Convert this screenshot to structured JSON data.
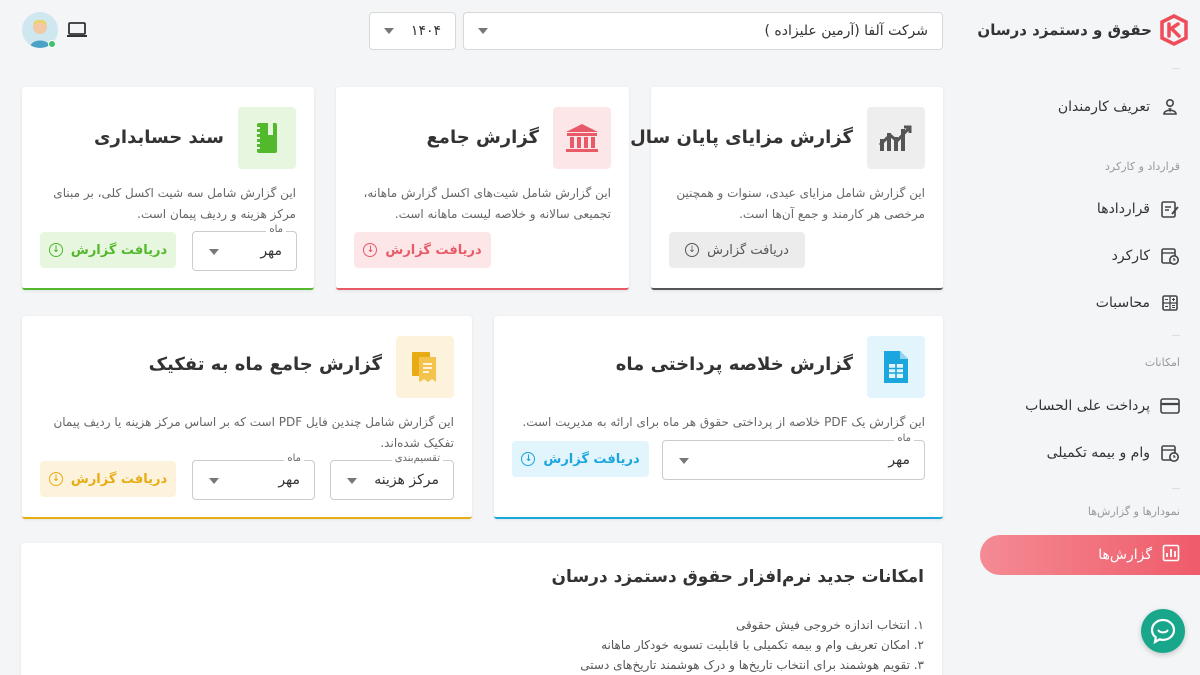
{
  "app": {
    "name": "حقوق و دستمزد درسان"
  },
  "topbar": {
    "company_selected": "شرکت آلفا (آرمین علیزاده )",
    "year_selected": "۱۴۰۴"
  },
  "sidebar": {
    "items": [
      {
        "label": "تعریف کارمندان",
        "icon": "employee-icon"
      },
      {
        "label": "قراردادها",
        "icon": "contract-icon"
      },
      {
        "label": "کارکرد",
        "icon": "worktime-icon"
      },
      {
        "label": "محاسبات",
        "icon": "calculator-icon"
      },
      {
        "label": "پرداخت علی الحساب",
        "icon": "card-icon"
      },
      {
        "label": "وام و بیمه تکمیلی",
        "icon": "loan-icon"
      },
      {
        "label": "گزارش‌ها",
        "icon": "reports-icon"
      }
    ],
    "sections": {
      "contracts": "قرارداد و کارکرد",
      "features": "امکانات",
      "reports": "نمودارها و گزارش‌ها"
    }
  },
  "cards": {
    "year_end": {
      "title": "گزارش مزایای پایان سال",
      "desc_line1": "این گزارش شامل مزایای عیدی، سنوات و همچنین",
      "desc_line2": "مرخصی هر کارمند و جمع آن‌ها است.",
      "button": "دریافت گزارش",
      "color": "#555555"
    },
    "comprehensive": {
      "title": "گزارش جامع",
      "desc_line1": "این گزارش شامل شیت‌های اکسل گزارش ماهانه،",
      "desc_line2": "تجمیعی سالانه و خلاصه لیست ماهانه است.",
      "button": "دریافت گزارش",
      "color": "#e85a67"
    },
    "accounting": {
      "title": "سند حسابداری",
      "desc_line1": "این گزارش شامل سه شیت اکسل کلی، بر مبنای",
      "desc_line2": "مرکز هزینه و ردیف پیمان است.",
      "button": "دریافت گزارش",
      "month_label": "ماه",
      "month_value": "مهر",
      "color": "#52b82c"
    },
    "payment_summary": {
      "title": "گزارش خلاصه پرداختی ماه",
      "desc_line1": "این گزارش یک PDF خلاصه از پرداختی حقوق هر ماه برای ارائه به مدیریت است.",
      "button": "دریافت گزارش",
      "month_label": "ماه",
      "month_value": "مهر",
      "color": "#1ba6dd"
    },
    "monthly_breakdown": {
      "title": "گزارش جامع ماه به تفکیک",
      "desc_line1": "این گزارش شامل چندین فایل PDF است که بر اساس مرکز هزینه یا ردیف پیمان",
      "desc_line2": "تفکیک شده‌اند.",
      "button": "دریافت گزارش",
      "category_label": "تقسیم‌بندی",
      "category_value": "مرکز هزینه",
      "month_label": "ماه",
      "month_value": "مهر",
      "color": "#e8ab14"
    }
  },
  "news": {
    "title": "امکانات جدید نرم‌افزار حقوق دستمزد درسان",
    "items": [
      "۱. انتخاب اندازه خروجی فیش حقوقی",
      "۲. امکان تعریف وام و بیمه تکمیلی با قابلیت تسویه خودکار ماهانه",
      "۳. تقویم هوشمند برای انتخاب تاریخ‌ها و درک هوشمند تاریخ‌های دستی"
    ]
  },
  "colors": {
    "accent_red": "#ef5b6a",
    "chat_green": "#18a78b"
  }
}
